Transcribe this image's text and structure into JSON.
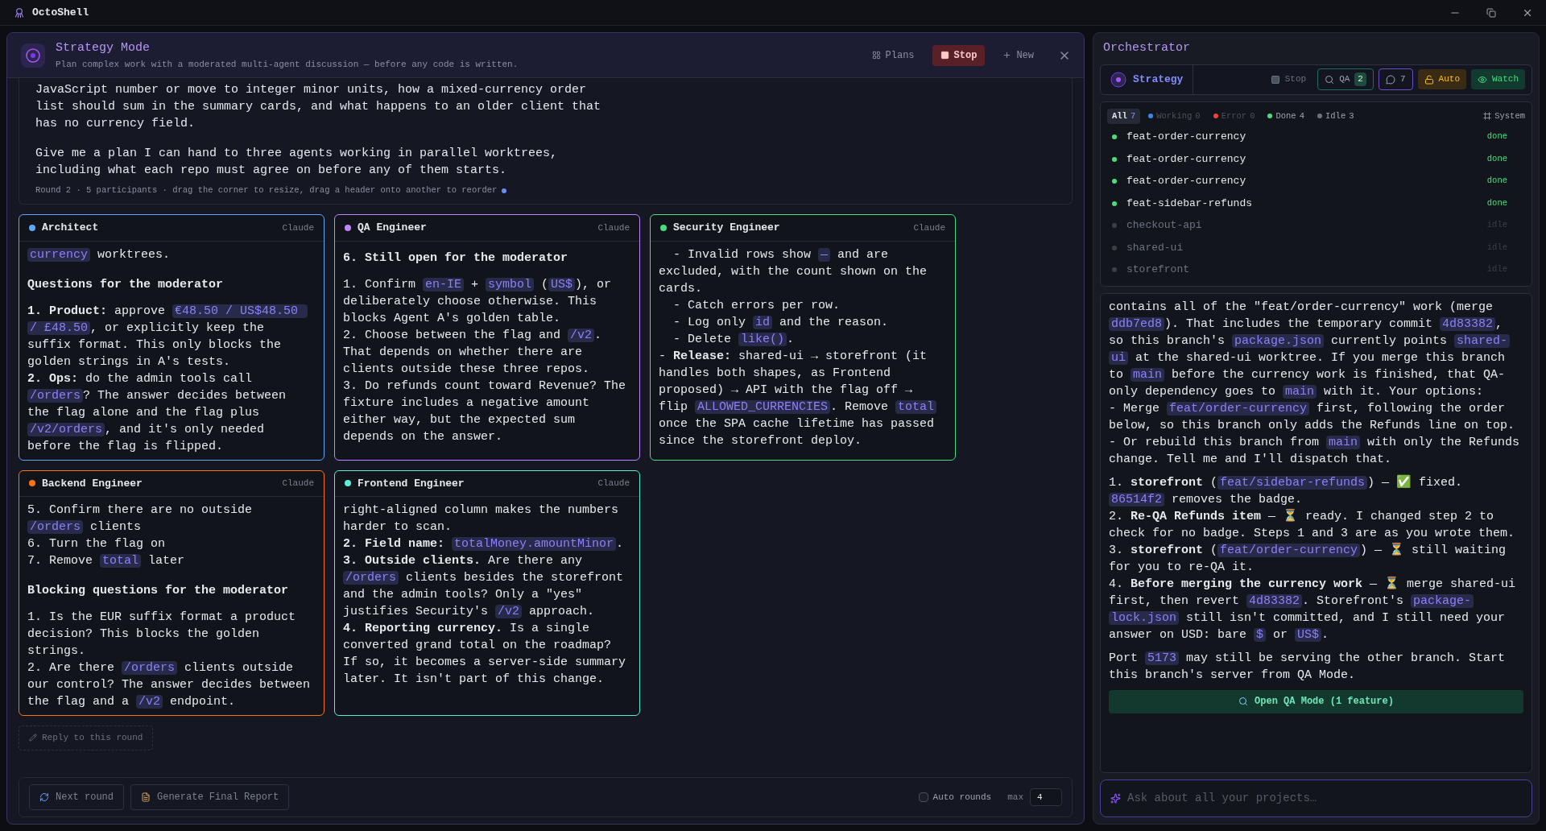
{
  "app": {
    "title": "OctoShell"
  },
  "strategy": {
    "title": "Strategy Mode",
    "subtitle": "Plan complex work with a moderated multi-agent discussion — before any code is written.",
    "actions": [
      {
        "kind": "plans",
        "label": "Plans"
      },
      {
        "kind": "stop",
        "label": "Stop"
      },
      {
        "kind": "new",
        "label": "New"
      }
    ]
  },
  "prompt": {
    "paragraphs": [
      "JavaScript number or move to integer minor units, how a mixed-currency order\nlist should sum in the summary cards, and what happens to an older client that\nhas no currency field.",
      "Give me a plan I can hand to three agents working in parallel worktrees,\nincluding what each repo must agree on before any of them starts."
    ],
    "meta": "Round 2 · 5 participants · drag the corner to resize, drag a header onto another to reorder"
  },
  "cards": [
    {
      "name": "Architect",
      "model": "Claude",
      "color": "#60a5fa",
      "blocks": [
        {
          "kind": "p",
          "parts": [
            {
              "kind": "code",
              "text": "currency"
            },
            {
              "kind": "text",
              "text": " worktrees."
            }
          ]
        },
        {
          "kind": "h",
          "text": "Questions for the moderator"
        },
        {
          "kind": "p",
          "parts": [
            {
              "kind": "text",
              "text": "**1. Product:** approve "
            },
            {
              "kind": "code",
              "text": "€48.50 / US$48.50 / £48.50"
            },
            {
              "kind": "text",
              "text": ", or explicitly keep the suffix format. This only blocks the golden strings in A's tests.\n**2. Ops:** do the admin tools call "
            },
            {
              "kind": "code",
              "text": "/orders"
            },
            {
              "kind": "text",
              "text": "? The answer decides between the flag alone and the flag plus "
            },
            {
              "kind": "code",
              "text": "/v2/orders"
            },
            {
              "kind": "text",
              "text": ", and it's only needed before the flag is flipped."
            }
          ]
        }
      ]
    },
    {
      "name": "QA Engineer",
      "model": "Claude",
      "color": "#c084fc",
      "blocks": [
        {
          "kind": "h",
          "text": "6. Still open for the moderator"
        },
        {
          "kind": "p",
          "parts": [
            {
              "kind": "text",
              "text": "1. Confirm "
            },
            {
              "kind": "code",
              "text": "en-IE"
            },
            {
              "kind": "text",
              "text": " + "
            },
            {
              "kind": "code",
              "text": "symbol"
            },
            {
              "kind": "text",
              "text": " ("
            },
            {
              "kind": "code",
              "text": "US$"
            },
            {
              "kind": "text",
              "text": "), or deliberately choose otherwise. This blocks Agent A's golden table.\n2. Choose between the flag and "
            },
            {
              "kind": "code",
              "text": "/v2"
            },
            {
              "kind": "text",
              "text": ". That depends on whether there are clients outside these three repos.\n3. Do refunds count toward Revenue? The fixture includes a negative amount either way, but the expected sum depends on the answer."
            }
          ]
        }
      ]
    },
    {
      "name": "Security Engineer",
      "model": "Claude",
      "color": "#4ade80",
      "blocks": [
        {
          "kind": "p",
          "parts": [
            {
              "kind": "text",
              "text": "  - Invalid rows show "
            },
            {
              "kind": "code",
              "text": "—"
            },
            {
              "kind": "text",
              "text": " and are excluded, with the count shown on the cards.\n  - Catch errors per row.\n  - Log only "
            },
            {
              "kind": "code",
              "text": "id"
            },
            {
              "kind": "text",
              "text": " and the reason.\n  - Delete "
            },
            {
              "kind": "code",
              "text": "like()"
            },
            {
              "kind": "text",
              "text": ".\n- **Release:** shared-ui → storefront (it handles both shapes, as Frontend proposed) → API with the flag off → flip "
            },
            {
              "kind": "code",
              "text": "ALLOWED_CURRENCIES"
            },
            {
              "kind": "text",
              "text": ". Remove "
            },
            {
              "kind": "code",
              "text": "total"
            },
            {
              "kind": "text",
              "text": " once the SPA cache lifetime has passed since the storefront deploy."
            }
          ]
        }
      ]
    },
    {
      "name": "Backend Engineer",
      "model": "Claude",
      "color": "#f97316",
      "blocks": [
        {
          "kind": "p",
          "parts": [
            {
              "kind": "text",
              "text": "5. Confirm there are no outside "
            },
            {
              "kind": "code",
              "text": "/orders"
            },
            {
              "kind": "text",
              "text": " clients\n6. Turn the flag on\n7. Remove "
            },
            {
              "kind": "code",
              "text": "total"
            },
            {
              "kind": "text",
              "text": " later"
            }
          ]
        },
        {
          "kind": "h",
          "text": "Blocking questions for the moderator"
        },
        {
          "kind": "p",
          "parts": [
            {
              "kind": "text",
              "text": "1. Is the EUR suffix format a product decision? This blocks the golden strings.\n2. Are there "
            },
            {
              "kind": "code",
              "text": "/orders"
            },
            {
              "kind": "text",
              "text": " clients outside our control? The answer decides between the flag and a "
            },
            {
              "kind": "code",
              "text": "/v2"
            },
            {
              "kind": "text",
              "text": " endpoint."
            }
          ]
        }
      ]
    },
    {
      "name": "Frontend Engineer",
      "model": "Claude",
      "color": "#5eead4",
      "blocks": [
        {
          "kind": "p",
          "parts": [
            {
              "kind": "text",
              "text": "right-aligned column makes the numbers harder to scan.\n**2. Field name:** "
            },
            {
              "kind": "code",
              "text": "totalMoney.amountMinor"
            },
            {
              "kind": "text",
              "text": ".\n**3. Outside clients.** Are there any "
            },
            {
              "kind": "code",
              "text": "/orders"
            },
            {
              "kind": "text",
              "text": " clients besides the storefront and the admin tools? Only a \"yes\" justifies Security's "
            },
            {
              "kind": "code",
              "text": "/v2"
            },
            {
              "kind": "text",
              "text": " approach.\n**4. Reporting currency.** Is a single converted grand total on the roadmap? If so, it becomes a server-side summary later. It isn't part of this change."
            }
          ]
        }
      ]
    }
  ],
  "reply": {
    "label": "Reply to this round"
  },
  "footer": {
    "buttons": [
      {
        "kind": "next",
        "label": "Next round"
      },
      {
        "kind": "report",
        "label": "Generate Final Report"
      }
    ],
    "auto_rounds": {
      "label": "Auto rounds",
      "checked": false
    },
    "max": {
      "label": "max",
      "value": "4"
    }
  },
  "orchestrator": {
    "title": "Orchestrator",
    "mode": "Strategy",
    "controls": [
      {
        "kind": "stop",
        "label": "Stop"
      },
      {
        "kind": "qa",
        "label": "QA",
        "count": "2"
      },
      {
        "kind": "chat",
        "count": "7"
      },
      {
        "kind": "auto",
        "label": "Auto"
      },
      {
        "kind": "watch",
        "label": "Watch"
      }
    ],
    "filters": [
      {
        "label": "All",
        "count": "7",
        "selected": true,
        "disabled": false
      },
      {
        "label": "Working",
        "count": "0",
        "color": "#3b82f6",
        "selected": false,
        "disabled": true
      },
      {
        "label": "Error",
        "count": "0",
        "color": "#ef4444",
        "selected": false,
        "disabled": true
      },
      {
        "label": "Done",
        "count": "4",
        "color": "#4ade80",
        "selected": false,
        "disabled": false
      },
      {
        "label": "Idle",
        "count": "3",
        "color": "#6b7280",
        "selected": false,
        "disabled": false
      }
    ],
    "system": "System",
    "worktrees": [
      {
        "name": "feat-order-currency",
        "status": "done",
        "kind": "done"
      },
      {
        "name": "feat-order-currency",
        "status": "done",
        "kind": "done"
      },
      {
        "name": "feat-order-currency",
        "status": "done",
        "kind": "done"
      },
      {
        "name": "feat-sidebar-refunds",
        "status": "done",
        "kind": "done"
      },
      {
        "name": "checkout-api",
        "status": "idle",
        "kind": "idle"
      },
      {
        "name": "shared-ui",
        "status": "idle",
        "kind": "idle"
      },
      {
        "name": "storefront",
        "status": "idle",
        "kind": "idle"
      }
    ],
    "messages": [
      [
        {
          "kind": "text",
          "text": "contains all of the \"feat/order-currency\" work (merge "
        },
        {
          "kind": "code",
          "text": "ddb7ed8"
        },
        {
          "kind": "text",
          "text": "). That includes the temporary commit "
        },
        {
          "kind": "code",
          "text": "4d83382"
        },
        {
          "kind": "text",
          "text": ", so this branch's "
        },
        {
          "kind": "code",
          "text": "package.json"
        },
        {
          "kind": "text",
          "text": " currently points "
        },
        {
          "kind": "code",
          "text": "shared-ui"
        },
        {
          "kind": "text",
          "text": " at the shared-ui worktree. If you merge this branch to "
        },
        {
          "kind": "code",
          "text": "main"
        },
        {
          "kind": "text",
          "text": " before the currency work is finished, that QA-only dependency goes to "
        },
        {
          "kind": "code",
          "text": "main"
        },
        {
          "kind": "text",
          "text": " with it. Your options:\n- Merge "
        },
        {
          "kind": "code",
          "text": "feat/order-currency"
        },
        {
          "kind": "text",
          "text": " first, following the order below, so this branch only adds the Refunds line on top.\n- Or rebuild this branch from "
        },
        {
          "kind": "code",
          "text": "main"
        },
        {
          "kind": "text",
          "text": " with only the Refunds change. Tell me and I'll dispatch that."
        }
      ],
      [
        {
          "kind": "text",
          "text": "1. **storefront** ("
        },
        {
          "kind": "code",
          "text": "feat/sidebar-refunds"
        },
        {
          "kind": "text",
          "text": ") — ✅ fixed. "
        },
        {
          "kind": "code",
          "text": "86514f2"
        },
        {
          "kind": "text",
          "text": " removes the badge.\n2. **Re-QA Refunds item** — ⏳ ready. I changed step 2 to check for no badge. Steps 1 and 3 are as you wrote them.\n3. **storefront** ("
        },
        {
          "kind": "code",
          "text": "feat/order-currency"
        },
        {
          "kind": "text",
          "text": ") — ⏳ still waiting for you to re-QA it.\n4. **Before merging the currency work** — ⏳ merge shared-ui first, then revert "
        },
        {
          "kind": "code",
          "text": "4d83382"
        },
        {
          "kind": "text",
          "text": ". Storefront's "
        },
        {
          "kind": "code",
          "text": "package-lock.json"
        },
        {
          "kind": "text",
          "text": " still isn't committed, and I still need your answer on USD: bare "
        },
        {
          "kind": "code",
          "text": "$"
        },
        {
          "kind": "text",
          "text": " or "
        },
        {
          "kind": "code",
          "text": "US$"
        },
        {
          "kind": "text",
          "text": "."
        }
      ],
      [
        {
          "kind": "text",
          "text": "Port "
        },
        {
          "kind": "code",
          "text": "5173"
        },
        {
          "kind": "text",
          "text": " may still be serving the other branch. Start this branch's server from QA Mode."
        }
      ]
    ],
    "qa_button": "Open QA Mode (1 feature)",
    "input": {
      "placeholder": "Ask about all your projects…"
    }
  }
}
